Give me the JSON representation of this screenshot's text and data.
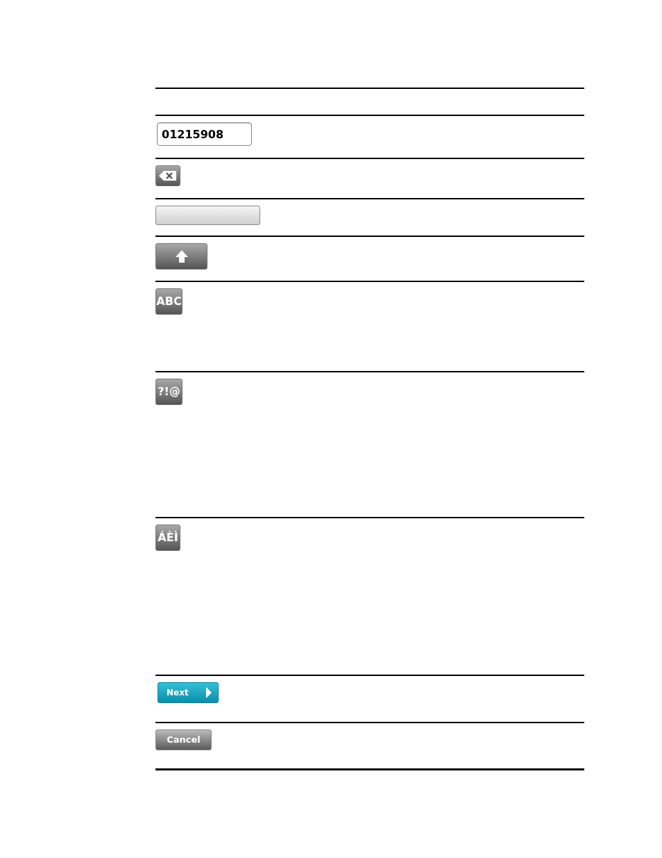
{
  "rows": [
    {
      "kind": "field",
      "value": "01215908"
    },
    {
      "kind": "backspace"
    },
    {
      "kind": "space"
    },
    {
      "kind": "shift"
    },
    {
      "kind": "key",
      "label": "ABC"
    },
    {
      "kind": "key",
      "label": "?!@"
    },
    {
      "kind": "key",
      "label": "ÁÈÌ"
    },
    {
      "kind": "next",
      "label": "Next"
    },
    {
      "kind": "cancel",
      "label": "Cancel"
    }
  ]
}
